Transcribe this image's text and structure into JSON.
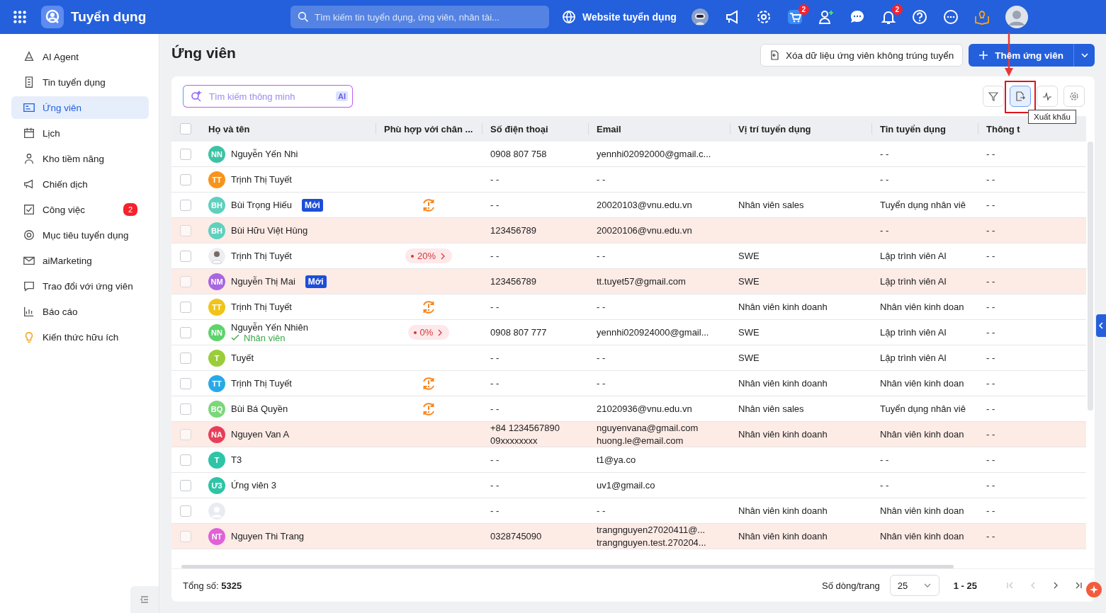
{
  "app": {
    "title": "Tuyển dụng",
    "search_placeholder": "Tìm kiếm tin tuyển dụng, ứng viên, nhân tài...",
    "website_link": "Website tuyển dụng",
    "cart_badge": "2",
    "bell_badge": "2"
  },
  "sidebar": {
    "items": [
      {
        "label": "AI Agent",
        "selected": false
      },
      {
        "label": "Tin tuyển dụng",
        "selected": false
      },
      {
        "label": "Ứng viên",
        "selected": true
      },
      {
        "label": "Lịch",
        "selected": false
      },
      {
        "label": "Kho tiềm năng",
        "selected": false
      },
      {
        "label": "Chiến dịch",
        "selected": false
      },
      {
        "label": "Công việc",
        "selected": false,
        "badge": "2"
      },
      {
        "label": "Mục tiêu tuyển dụng",
        "selected": false
      },
      {
        "label": "aiMarketing",
        "selected": false
      },
      {
        "label": "Trao đổi với ứng viên",
        "selected": false
      },
      {
        "label": "Báo cáo",
        "selected": false
      },
      {
        "label": "Kiến thức hữu ích",
        "selected": false
      }
    ]
  },
  "page": {
    "title": "Ứng viên",
    "delete_button": "Xóa dữ liệu ứng viên không trúng tuyển",
    "add_button": "Thêm ứng viên"
  },
  "smart_search": {
    "placeholder": "Tìm kiếm thông minh",
    "ai_label": "AI"
  },
  "tooltip": "Xuất khẩu",
  "table": {
    "all_checked": false,
    "columns": [
      "Họ và tên",
      "Phù hợp với chân ...",
      "Số điện thoại",
      "Email",
      "Vị trí tuyển dụng",
      "Tin tuyển dụng",
      "Thông t"
    ],
    "rows": [
      {
        "checked": false,
        "highlighted": false,
        "avatar": {
          "kind": "initials",
          "initials": "NN",
          "color": "#3cc3a5"
        },
        "name": "Nguyễn Yến Nhi",
        "phone": [
          "0908 807 758"
        ],
        "email": [
          "yennhi02092000@gmail.c..."
        ],
        "position": "",
        "job": "- -",
        "info": "- -"
      },
      {
        "checked": false,
        "highlighted": false,
        "avatar": {
          "kind": "initials",
          "initials": "TT",
          "color": "#f7941d"
        },
        "name": "Trịnh Thị Tuyết",
        "phone": [
          "- -"
        ],
        "email": [
          "- -"
        ],
        "position": "",
        "job": "- -",
        "info": "- -"
      },
      {
        "checked": false,
        "highlighted": false,
        "avatar": {
          "kind": "initials",
          "initials": "BH",
          "color": "#5fd0be"
        },
        "name": "Bùi Trọng Hiếu",
        "badge": "Mới",
        "match": {
          "kind": "warning"
        },
        "phone": [
          "- -"
        ],
        "email": [
          "20020103@vnu.edu.vn"
        ],
        "position": "Nhân viên sales",
        "job": "Tuyển dụng nhân viê",
        "info": "- -"
      },
      {
        "checked": false,
        "highlighted": true,
        "avatar": {
          "kind": "initials",
          "initials": "BH",
          "color": "#5fd0be"
        },
        "name": "Bùi Hữu Việt Hùng",
        "phone": [
          "123456789"
        ],
        "email": [
          "20020106@vnu.edu.vn"
        ],
        "position": "",
        "job": "- -",
        "info": "- -"
      },
      {
        "checked": false,
        "highlighted": false,
        "avatar": {
          "kind": "photo"
        },
        "name": "Trịnh Thị Tuyết",
        "match": {
          "kind": "percent",
          "text": "20%"
        },
        "phone": [
          "- -"
        ],
        "email": [
          "- -"
        ],
        "position": "SWE",
        "job": "Lập trình viên AI",
        "info": "- -"
      },
      {
        "checked": false,
        "highlighted": true,
        "avatar": {
          "kind": "initials",
          "initials": "NM",
          "color": "#a866e0"
        },
        "name": "Nguyễn Thị Mai",
        "badge": "Mới",
        "phone": [
          "123456789"
        ],
        "email": [
          "tt.tuyet57@gmail.com"
        ],
        "position": "SWE",
        "job": "Lập trình viên AI",
        "info": "- -"
      },
      {
        "checked": false,
        "highlighted": false,
        "avatar": {
          "kind": "initials",
          "initials": "TT",
          "color": "#f0c419"
        },
        "name": "Trịnh Thị Tuyết",
        "match": {
          "kind": "warning"
        },
        "phone": [
          "- -"
        ],
        "email": [
          "- -"
        ],
        "position": "Nhân viên kinh doanh",
        "job": "Nhân viên kinh doan",
        "info": "- -"
      },
      {
        "checked": false,
        "highlighted": false,
        "avatar": {
          "kind": "initials",
          "initials": "NN",
          "color": "#5dd36b"
        },
        "name": "Nguyễn Yến Nhiên",
        "subtitle": "Nhân viên",
        "match": {
          "kind": "percent",
          "text": "0%"
        },
        "phone": [
          "0908 807 777"
        ],
        "email": [
          "yennhi020924000@gmail..."
        ],
        "position": "SWE",
        "job": "Lập trình viên AI",
        "info": "- -"
      },
      {
        "checked": false,
        "highlighted": false,
        "avatar": {
          "kind": "initials",
          "initials": "T",
          "color": "#9bcd3a"
        },
        "name": "Tuyết",
        "phone": [
          "- -"
        ],
        "email": [
          "- -"
        ],
        "position": "SWE",
        "job": "Lập trình viên AI",
        "info": "- -"
      },
      {
        "checked": false,
        "highlighted": false,
        "avatar": {
          "kind": "initials",
          "initials": "TT",
          "color": "#27a9e8"
        },
        "name": "Trịnh Thị Tuyết",
        "match": {
          "kind": "warning"
        },
        "phone": [
          "- -"
        ],
        "email": [
          "- -"
        ],
        "position": "Nhân viên kinh doanh",
        "job": "Nhân viên kinh doan",
        "info": "- -"
      },
      {
        "checked": false,
        "highlighted": false,
        "avatar": {
          "kind": "initials",
          "initials": "BQ",
          "color": "#7cd67a"
        },
        "name": "Bùi Bá Quyền",
        "match": {
          "kind": "warning"
        },
        "phone": [
          "- -"
        ],
        "email": [
          "21020936@vnu.edu.vn"
        ],
        "position": "Nhân viên sales",
        "job": "Tuyển dụng nhân viê",
        "info": "- -"
      },
      {
        "checked": false,
        "highlighted": true,
        "avatar": {
          "kind": "initials",
          "initials": "NA",
          "color": "#e83e5a"
        },
        "name": "Nguyen Van A",
        "phone": [
          "+84 1234567890",
          "09xxxxxxxx"
        ],
        "email": [
          "nguyenvana@gmail.com",
          "huong.le@email.com"
        ],
        "position": "Nhân viên kinh doanh",
        "job": "Nhân viên kinh doan",
        "info": "- -"
      },
      {
        "checked": false,
        "highlighted": false,
        "avatar": {
          "kind": "initials",
          "initials": "T",
          "color": "#2ec4a7"
        },
        "name": "T3",
        "phone": [
          "- -"
        ],
        "email": [
          "t1@ya.co"
        ],
        "position": "",
        "job": "- -",
        "info": "- -"
      },
      {
        "checked": false,
        "highlighted": false,
        "avatar": {
          "kind": "initials",
          "initials": "Ư3",
          "color": "#2ec4a7"
        },
        "name": "Ứng viên 3",
        "phone": [
          "- -"
        ],
        "email": [
          "uv1@gmail.co"
        ],
        "position": "",
        "job": "- -",
        "info": "- -"
      },
      {
        "checked": false,
        "highlighted": false,
        "avatar": {
          "kind": "blank"
        },
        "name": "",
        "phone": [
          "- -"
        ],
        "email": [
          "- -"
        ],
        "position": "Nhân viên kinh doanh",
        "job": "Nhân viên kinh doan",
        "info": "- -"
      },
      {
        "checked": false,
        "highlighted": true,
        "avatar": {
          "kind": "initials",
          "initials": "NT",
          "color": "#e062d8"
        },
        "name": "Nguyen Thi Trang",
        "phone": [
          "0328745090"
        ],
        "email": [
          "trangnguyen27020411@...",
          "trangnguyen.test.270204..."
        ],
        "position": "Nhân viên kinh doanh",
        "job": "Nhân viên kinh doan",
        "info": "- -"
      }
    ]
  },
  "footer": {
    "total_label": "Tổng số:",
    "total": "5325",
    "page_size_label": "Số dòng/trang",
    "page_size": "25",
    "range": "1 - 25"
  }
}
